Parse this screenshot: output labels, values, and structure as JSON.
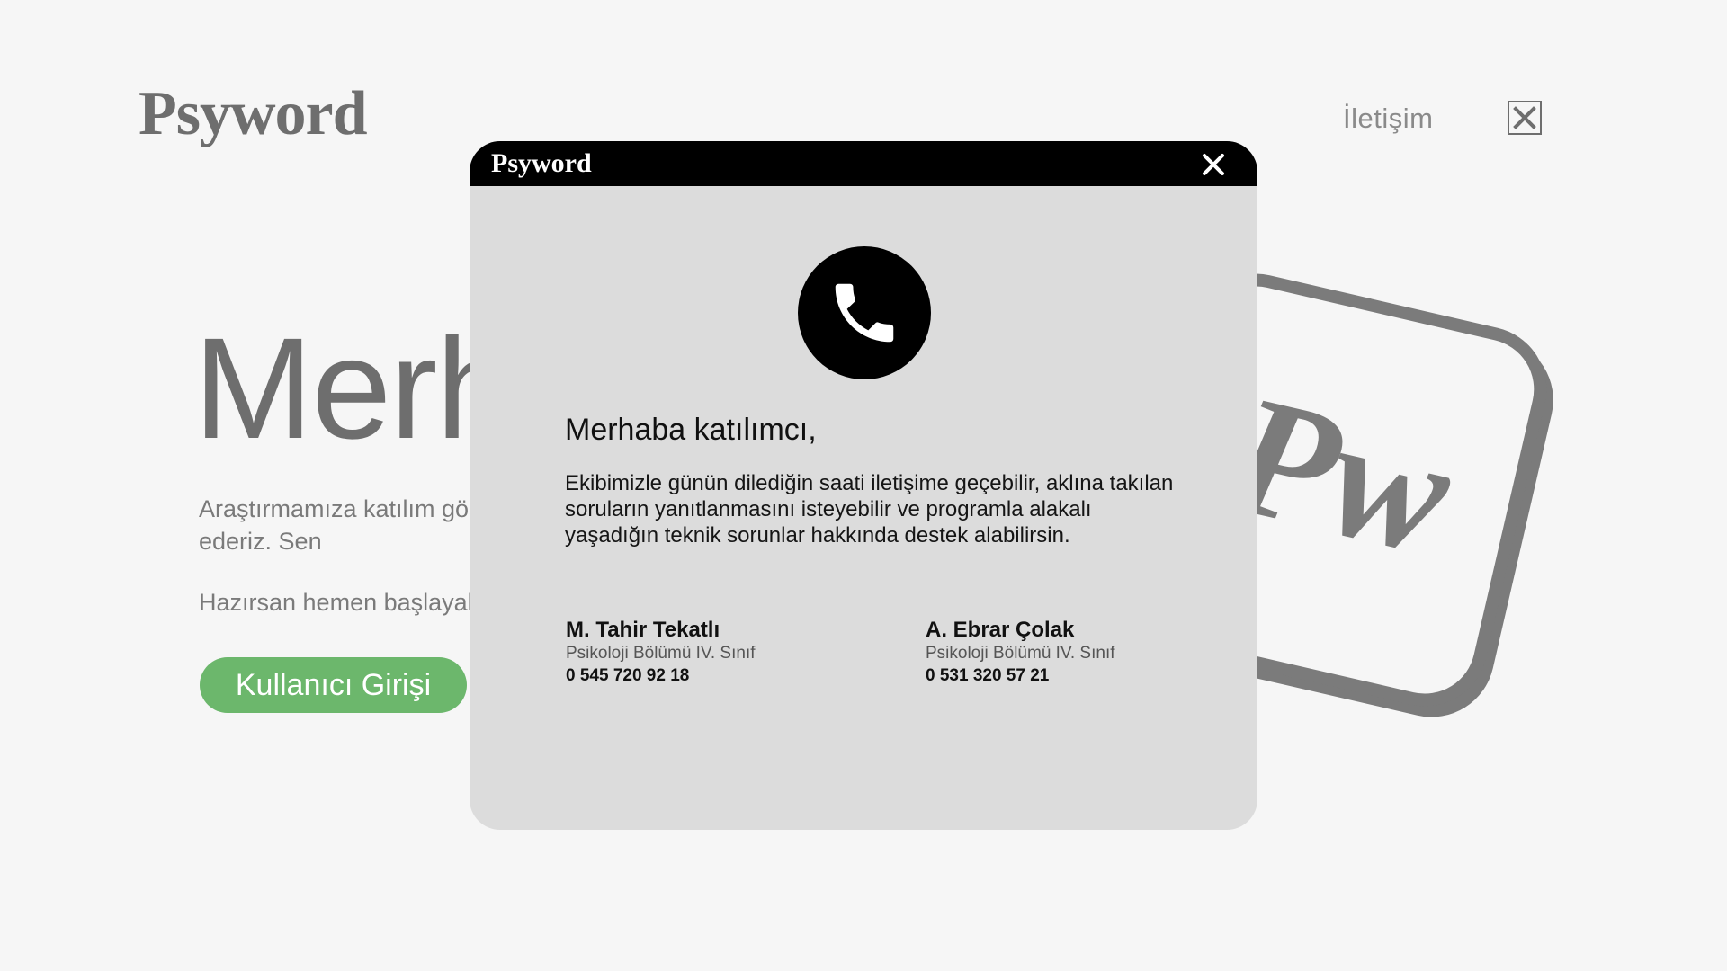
{
  "background": {
    "logo": "Psyword",
    "nav_contact": "İletişim",
    "heading": "Merhaba",
    "description": "Araştırmamıza katılım gösterdiğin için çok teşekkür ederiz. Sen",
    "ready_text": "Hazırsan hemen başlayalım",
    "login_button": "Kullanıcı Girişi",
    "badge_text": "Pw"
  },
  "modal": {
    "logo": "Psyword",
    "greeting": "Merhaba katılımcı,",
    "message": "Ekibimizle günün dilediğin saati iletişime geçebilir, aklına takılan soruların yanıtlanmasını isteyebilir ve programla alakalı yaşadığın teknik sorunlar hakkında destek alabilirsin.",
    "contacts": [
      {
        "name": "M. Tahir Tekatlı",
        "department": "Psikoloji Bölümü IV. Sınıf",
        "phone": "0 545 720 92 18"
      },
      {
        "name": "A. Ebrar Çolak",
        "department": "Psikoloji Bölümü IV. Sınıf",
        "phone": "0 531 320 57 21"
      }
    ]
  },
  "icons": {
    "modal_close": "close-icon",
    "phone": "phone-icon",
    "menu_close": "close-box-icon"
  },
  "colors": {
    "accent_green": "#6cb76c",
    "modal_header": "#000000",
    "modal_body": "#dcdcdc",
    "page_bg": "#f6f6f6"
  }
}
